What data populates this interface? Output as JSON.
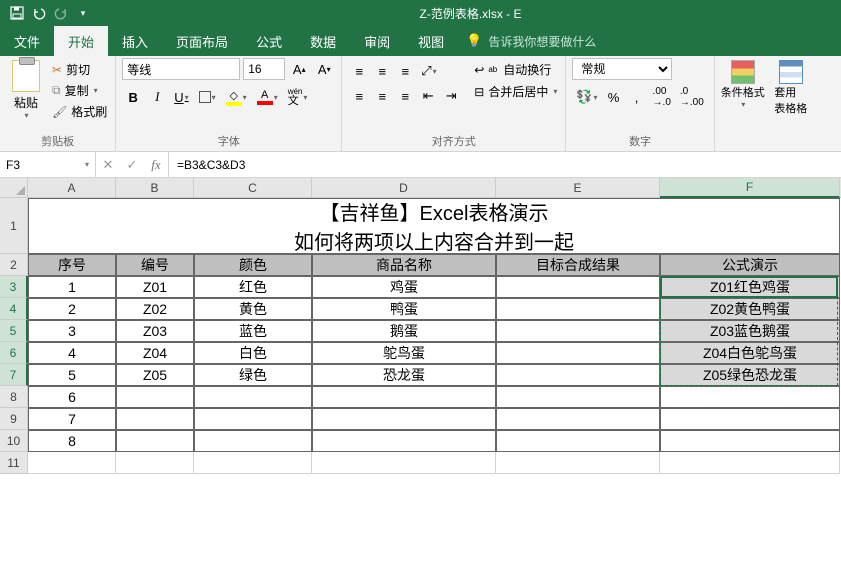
{
  "titlebar": {
    "filename": "Z-范例表格.xlsx - E"
  },
  "tabs": [
    "文件",
    "开始",
    "插入",
    "页面布局",
    "公式",
    "数据",
    "审阅",
    "视图"
  ],
  "active_tab": 1,
  "tellme": "告诉我你想要做什么",
  "ribbon": {
    "clipboard": {
      "paste": "粘贴",
      "cut": "剪切",
      "copy": "复制",
      "format_painter": "格式刷",
      "group": "剪贴板"
    },
    "font": {
      "name": "等线",
      "size": "16",
      "group": "字体",
      "abc": "abc",
      "wen": "wén"
    },
    "align": {
      "wrap": "自动换行",
      "merge": "合并后居中",
      "group": "对齐方式"
    },
    "number": {
      "format": "常规",
      "group": "数字"
    },
    "styles": {
      "cf": "条件格式",
      "table": "套用\n表格格"
    }
  },
  "name_box": "F3",
  "formula": "=B3&C3&D3",
  "columns": [
    "A",
    "B",
    "C",
    "D",
    "E",
    "F"
  ],
  "rows": 11,
  "title_line1": "【吉祥鱼】Excel表格演示",
  "title_line2": "如何将两项以上内容合并到一起",
  "headers": [
    "序号",
    "编号",
    "颜色",
    "商品名称",
    "目标合成结果",
    "公式演示"
  ],
  "data_rows": [
    {
      "n": "1",
      "code": "Z01",
      "color": "红色",
      "name": "鸡蛋",
      "result": "Z01红色鸡蛋"
    },
    {
      "n": "2",
      "code": "Z02",
      "color": "黄色",
      "name": "鸭蛋",
      "result": "Z02黄色鸭蛋"
    },
    {
      "n": "3",
      "code": "Z03",
      "color": "蓝色",
      "name": "鹅蛋",
      "result": "Z03蓝色鹅蛋"
    },
    {
      "n": "4",
      "code": "Z04",
      "color": "白色",
      "name": "鸵鸟蛋",
      "result": "Z04白色鸵鸟蛋"
    },
    {
      "n": "5",
      "code": "Z05",
      "color": "绿色",
      "name": "恐龙蛋",
      "result": "Z05绿色恐龙蛋"
    }
  ],
  "extra_ns": [
    "6",
    "7",
    "8"
  ],
  "selected_col": "F",
  "selected_rows": [
    3,
    4,
    5,
    6,
    7
  ]
}
